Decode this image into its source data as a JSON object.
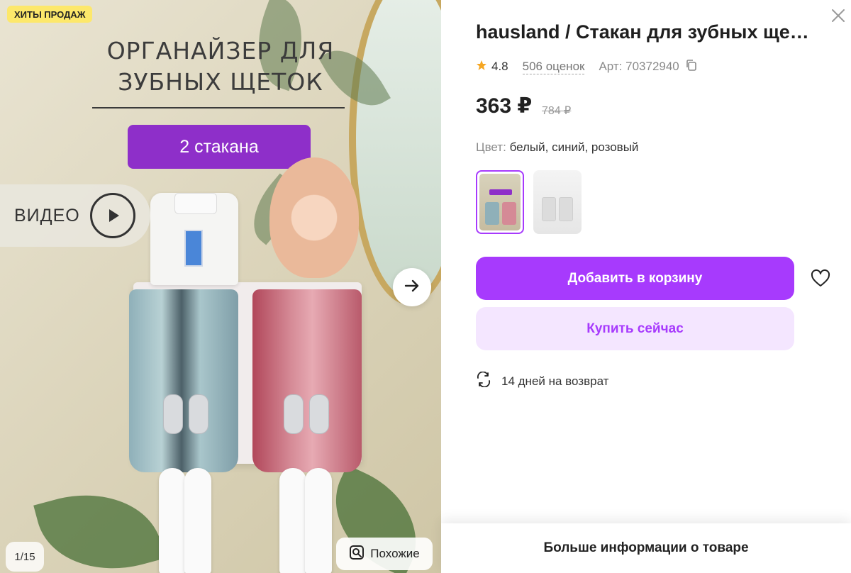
{
  "gallery": {
    "badge": "ХИТЫ ПРОДАЖ",
    "promo_title_line1": "ОРГАНАЙЗЕР ДЛЯ",
    "promo_title_line2": "ЗУБНЫХ ЩЕТОК",
    "promo_pill": "2 стакана",
    "video_label": "ВИДЕО",
    "counter": "1/15",
    "similar_label": "Похожие",
    "icons": [
      "play-icon",
      "arrow-right-icon",
      "similar-search-icon"
    ]
  },
  "product": {
    "title": "hausland / Стакан для зубных ще…",
    "rating": "4.8",
    "reviews": "506 оценок",
    "article": "Арт: 70372940",
    "price": "363 ₽",
    "old_price": "784 ₽",
    "color_label": "Цвет:",
    "color_value": "белый, синий, розовый"
  },
  "actions": {
    "add_to_cart": "Добавить в корзину",
    "buy_now": "Купить сейчас",
    "returns": "14 дней на возврат",
    "more_info": "Больше информации о товаре"
  },
  "colors": {
    "accent": "#a73afd",
    "accent_light": "#f4e6ff",
    "badge": "#fde86b",
    "star": "#f5a623"
  }
}
